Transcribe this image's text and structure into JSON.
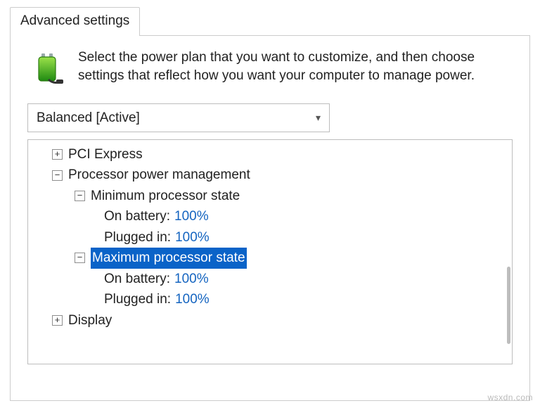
{
  "tab": {
    "label": "Advanced settings"
  },
  "intro": {
    "text": "Select the power plan that you want to customize, and then choose settings that reflect how you want your computer to manage power."
  },
  "plan_select": {
    "value": "Balanced [Active]"
  },
  "tree": {
    "pci_express": {
      "label": "PCI Express"
    },
    "processor": {
      "label": "Processor power management",
      "min_state": {
        "label": "Minimum processor state",
        "on_battery": {
          "label": "On battery:",
          "value": "100%"
        },
        "plugged_in": {
          "label": "Plugged in:",
          "value": "100%"
        }
      },
      "max_state": {
        "label": "Maximum processor state",
        "on_battery": {
          "label": "On battery:",
          "value": "100%"
        },
        "plugged_in": {
          "label": "Plugged in:",
          "value": "100%"
        }
      }
    },
    "display": {
      "label": "Display"
    }
  },
  "watermark": "wsxdn.com"
}
